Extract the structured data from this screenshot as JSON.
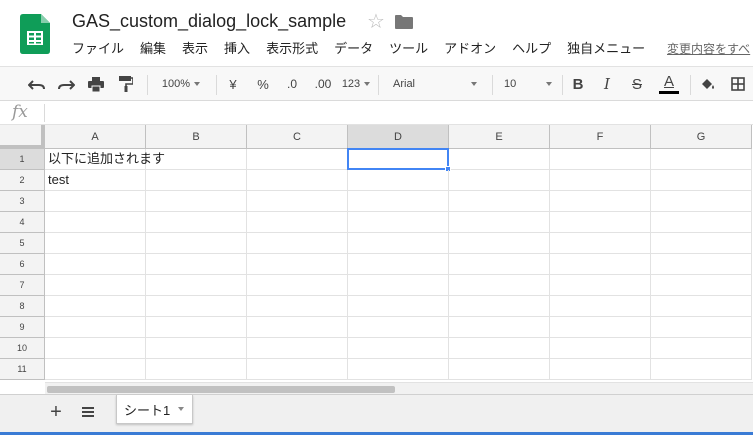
{
  "document": {
    "title": "GAS_custom_dialog_lock_sample",
    "star_glyph": "☆"
  },
  "menu": {
    "items": [
      "ファイル",
      "編集",
      "表示",
      "挿入",
      "表示形式",
      "データ",
      "ツール",
      "アドオン",
      "ヘルプ",
      "独自メニュー"
    ],
    "last_edit_link": "変更内容をすべ"
  },
  "toolbar": {
    "zoom": "100%",
    "currency": "¥",
    "percent": "%",
    "decrease_decimal": ".0",
    "increase_decimal": ".00",
    "more_formats": "123",
    "font": "Arial",
    "font_size": "10",
    "bold": "B",
    "italic": "I",
    "strikethrough": "S",
    "text_color": "A",
    "text_color_value": "#000000"
  },
  "formula_bar": {
    "fx_label": "fx",
    "value": ""
  },
  "grid": {
    "columns": [
      "A",
      "B",
      "C",
      "D",
      "E",
      "F",
      "G"
    ],
    "rows": [
      "1",
      "2",
      "3",
      "4",
      "5",
      "6",
      "7",
      "8",
      "9",
      "10",
      "11"
    ],
    "selected_cell": "D1",
    "cells": {
      "A1": "以下に追加されます",
      "A2": "test"
    }
  },
  "sheets": {
    "add_glyph": "+",
    "active_tab": "シート1"
  },
  "colors": {
    "brand_green": "#0f9d58",
    "selection_blue": "#4285f4"
  }
}
